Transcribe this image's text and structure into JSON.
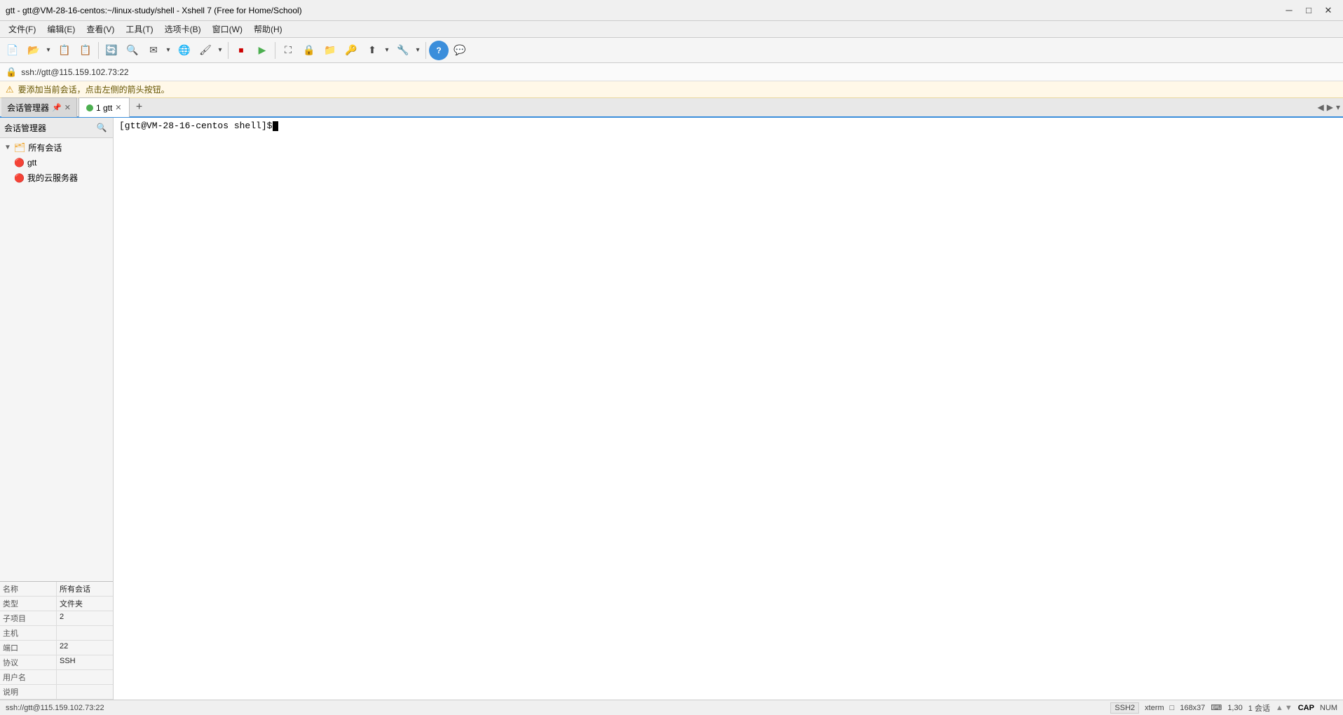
{
  "titleBar": {
    "title": "gtt - gtt@VM-28-16-centos:~/linux-study/shell - Xshell 7 (Free for Home/School)",
    "minimize": "─",
    "maximize": "□",
    "close": "✕"
  },
  "menuBar": {
    "items": [
      "文件(F)",
      "编辑(E)",
      "查看(V)",
      "工具(T)",
      "选项卡(B)",
      "窗口(W)",
      "帮助(H)"
    ]
  },
  "addressBar": {
    "address": "ssh://gtt@115.159.102.73:22"
  },
  "infoBar": {
    "text": "要添加当前会话，点击左侧的箭头按钮。"
  },
  "tabBar": {
    "sessionMgrLabel": "会话管理器",
    "tabs": [
      {
        "id": "tab1",
        "label": "1 gtt",
        "active": true
      }
    ],
    "addLabel": "+"
  },
  "sidebar": {
    "title": "",
    "searchTooltip": "搜索",
    "tree": [
      {
        "level": 1,
        "type": "folder-expand",
        "label": "所有会话",
        "expanded": true
      },
      {
        "level": 2,
        "type": "server",
        "label": "gtt"
      },
      {
        "level": 2,
        "type": "folder",
        "label": "我的云服务器"
      }
    ],
    "properties": [
      {
        "key": "名称",
        "value": "所有会话"
      },
      {
        "key": "类型",
        "value": "文件夹"
      },
      {
        "key": "子项目",
        "value": "2"
      },
      {
        "key": "主机",
        "value": ""
      },
      {
        "key": "端口",
        "value": "22"
      },
      {
        "key": "协议",
        "value": "SSH"
      },
      {
        "key": "用户名",
        "value": ""
      },
      {
        "key": "说明",
        "value": ""
      }
    ]
  },
  "terminal": {
    "prompt": "[gtt@VM-28-16-centos shell]$ "
  },
  "statusBar": {
    "address": "ssh://gtt@115.159.102.73:22",
    "protocol": "SSH2",
    "term": "xterm",
    "dimensions": "168x37",
    "position": "1,30",
    "sessions": "1 会话",
    "cap": "CAP",
    "num": "NUM"
  }
}
